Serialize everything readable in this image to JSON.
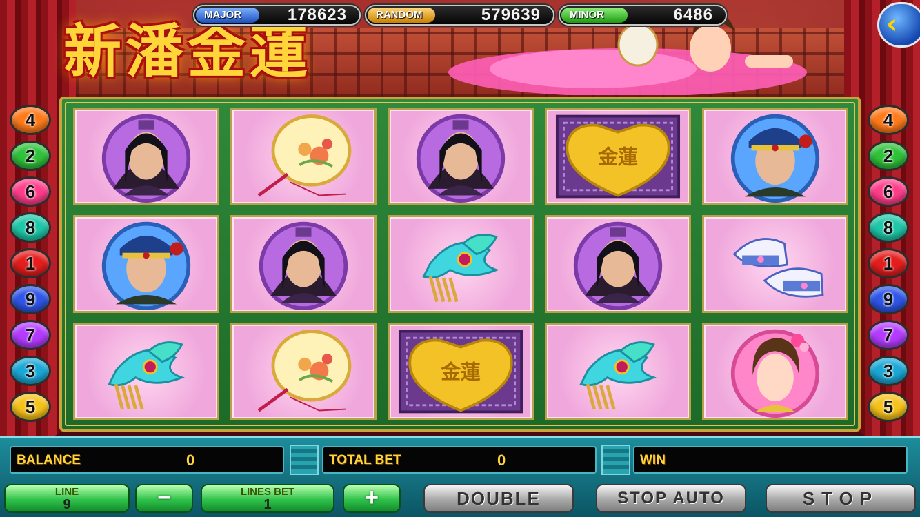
{
  "title": "新潘金蓮",
  "jackpots": {
    "major": {
      "label": "MAJOR",
      "value": "178623"
    },
    "random": {
      "label": "RANDOM",
      "value": "579639"
    },
    "minor": {
      "label": "MINOR",
      "value": "6486"
    }
  },
  "back_button": {
    "icon": "chevron-left-icon",
    "glyph": "‹"
  },
  "line_numbers_left": [
    "4",
    "2",
    "6",
    "8",
    "1",
    "9",
    "7",
    "3",
    "5"
  ],
  "line_numbers_right": [
    "4",
    "2",
    "6",
    "8",
    "1",
    "9",
    "7",
    "3",
    "5"
  ],
  "ball_colors": [
    "#ff7a1a",
    "#2fc23a",
    "#ff3d8a",
    "#1ec7a8",
    "#e51d1d",
    "#2f56e8",
    "#b43bff",
    "#1aa8d6",
    "#f6c21a"
  ],
  "reels": [
    [
      "scholar-symbol",
      "fan-symbol",
      "scholar-symbol",
      "gold-lock-symbol",
      "official-symbol"
    ],
    [
      "official-symbol",
      "scholar-symbol",
      "hairpin-symbol",
      "scholar-symbol",
      "embroidered-shoes-symbol"
    ],
    [
      "hairpin-symbol",
      "fan-symbol",
      "gold-lock-symbol",
      "hairpin-symbol",
      "lady-symbol"
    ]
  ],
  "gold_lock_text": "金蓮",
  "meters": {
    "balance": {
      "label": "BALANCE",
      "value": "0"
    },
    "total_bet": {
      "label": "TOTAL BET",
      "value": "0"
    },
    "win": {
      "label": "WIN",
      "value": ""
    }
  },
  "controls": {
    "line_label": "LINE",
    "line_value": "9",
    "minus_label": "−",
    "lines_bet_label": "LINES BET",
    "lines_bet_value": "1",
    "plus_label": "+",
    "double_label": "DOUBLE",
    "stop_auto_label": "STOP AUTO",
    "stop_label": "STOP"
  }
}
